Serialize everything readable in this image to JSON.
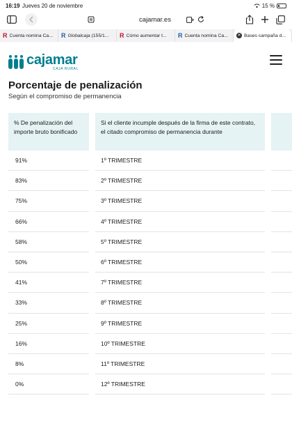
{
  "status_bar": {
    "time": "16:19",
    "date": "Jueves 20 de noviembre",
    "battery": "15 %"
  },
  "browser": {
    "url": "cajamar.es",
    "tabs": [
      {
        "label": "Cuenta nomina Ca...",
        "icon": "r-favicon",
        "active": false
      },
      {
        "label": "Globalcaja (155/1...",
        "icon": "r-favicon",
        "active": false
      },
      {
        "label": "Cómo aumentar t...",
        "icon": "r-favicon",
        "active": false
      },
      {
        "label": "Cuenta nomina Ca...",
        "icon": "r-favicon",
        "active": false
      },
      {
        "label": "Bases campaña d...",
        "icon": "close-icon",
        "active": true
      }
    ]
  },
  "site": {
    "logo_name": "cajamar",
    "logo_sub": "CAJA RURAL",
    "brand_color": "#007e8f"
  },
  "content": {
    "title": "Porcentaje de penalización",
    "subtitle": "Según el compromiso de permanencia",
    "table": {
      "headers": [
        "% De penalización del importe bruto bonificado",
        "Si el cliente incumple después de la firma de este contrato, el citado compromiso de permanencia durante"
      ],
      "rows": [
        [
          "91%",
          "1º TRIMESTRE"
        ],
        [
          "83%",
          "2º TRIMESTRE"
        ],
        [
          "75%",
          "3º TRIMESTRE"
        ],
        [
          "66%",
          "4º TRIMESTRE"
        ],
        [
          "58%",
          "5º TRIMESTRE"
        ],
        [
          "50%",
          "6º TRIMESTRE"
        ],
        [
          "41%",
          "7º TRIMESTRE"
        ],
        [
          "33%",
          "8º TRIMESTRE"
        ],
        [
          "25%",
          "9º TRIMESTRE"
        ],
        [
          "16%",
          "10º TRIMESTRE"
        ],
        [
          "8%",
          "11º TRIMESTRE"
        ],
        [
          "0%",
          "12º TRIMESTRE"
        ]
      ]
    }
  }
}
